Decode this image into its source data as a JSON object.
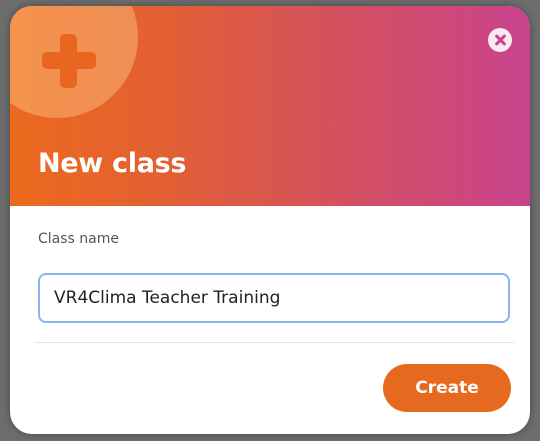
{
  "dialog": {
    "title": "New class",
    "header_icon": "plus-icon",
    "close_icon": "close-icon"
  },
  "form": {
    "class_name_label": "Class name",
    "class_name_value": "VR4Clima Teacher Training"
  },
  "actions": {
    "create_label": "Create"
  },
  "colors": {
    "gradient_start": "#ec6a1d",
    "gradient_end": "#c8438c",
    "accent": "#e56a1f",
    "input_focus_border": "#8ab4ee"
  }
}
